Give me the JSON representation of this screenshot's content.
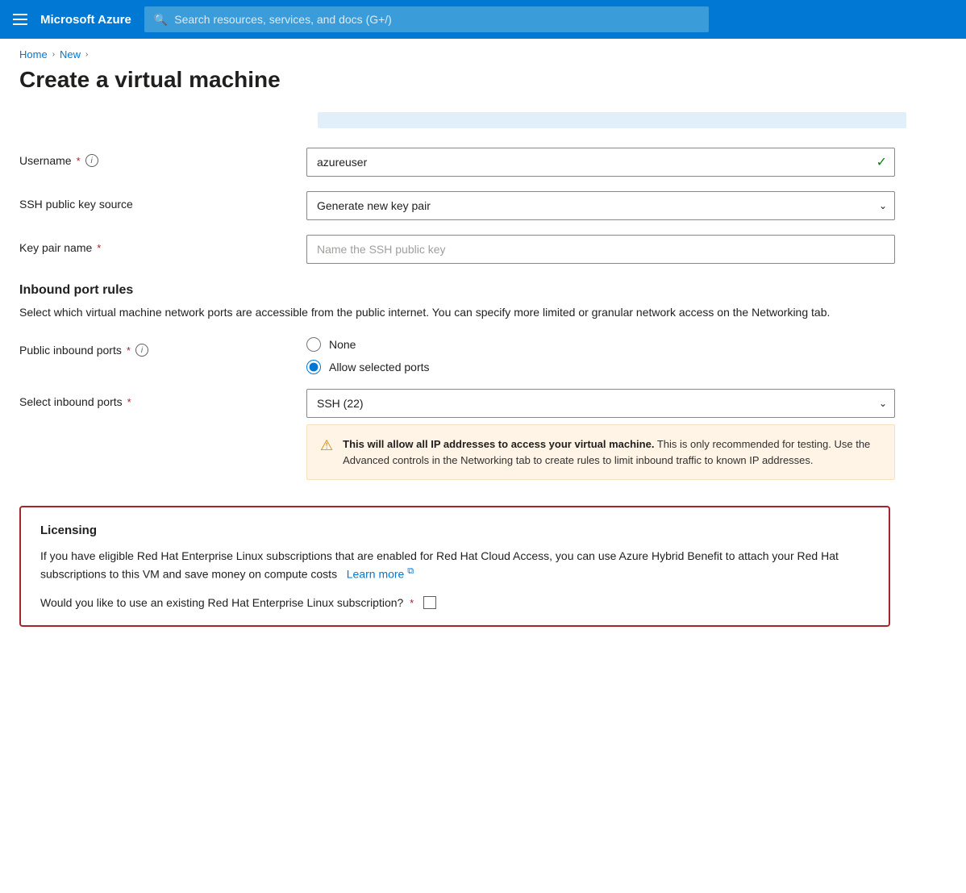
{
  "topnav": {
    "brand": "Microsoft Azure",
    "search_placeholder": "Search resources, services, and docs (G+/)"
  },
  "breadcrumb": {
    "home": "Home",
    "new": "New"
  },
  "page": {
    "title": "Create a virtual machine"
  },
  "form": {
    "username_label": "Username",
    "username_value": "azureuser",
    "ssh_source_label": "SSH public key source",
    "ssh_source_value": "Generate new key pair",
    "key_pair_label": "Key pair name",
    "key_pair_placeholder": "Name the SSH public key",
    "inbound_title": "Inbound port rules",
    "inbound_desc": "Select which virtual machine network ports are accessible from the public internet. You can specify more limited or granular network access on the Networking tab.",
    "public_ports_label": "Public inbound ports",
    "none_option": "None",
    "allow_option": "Allow selected ports",
    "select_ports_label": "Select inbound ports",
    "select_ports_value": "SSH (22)",
    "warning_text": "This will allow all IP addresses to access your virtual machine.",
    "warning_rest": " This is only recommended for testing.  Use the Advanced controls in the Networking tab to create rules to limit inbound traffic to known IP addresses.",
    "licensing_title": "Licensing",
    "licensing_desc": "If you have eligible Red Hat Enterprise Linux subscriptions that are enabled for Red Hat Cloud Access, you can use Azure Hybrid Benefit to attach your Red Hat subscriptions to this VM and save money on compute costs",
    "learn_more": "Learn more",
    "licensing_question": "Would you like to use an existing Red Hat Enterprise Linux subscription?",
    "required_star": "*"
  }
}
